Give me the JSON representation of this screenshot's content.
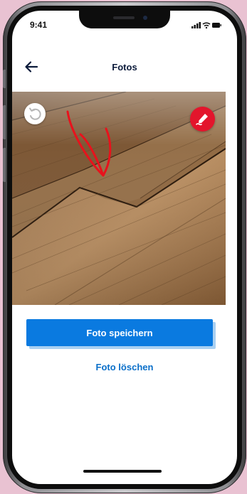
{
  "status_bar": {
    "time": "9:41",
    "icons": [
      "signal-icon",
      "wifi-icon",
      "battery-icon"
    ]
  },
  "header": {
    "title": "Fotos",
    "back_icon": "arrow-left-icon"
  },
  "photo": {
    "description_icon_left": "reset-rotate-icon",
    "description_icon_right": "draw-pen-icon",
    "annotation_color": "#e8121c"
  },
  "actions": {
    "save_label": "Foto speichern",
    "delete_label": "Foto löschen"
  },
  "colors": {
    "primary": "#0a7ae0",
    "primary_shadow": "#a9d0f2",
    "link": "#0a6fc9",
    "title": "#0b1a3a",
    "draw_button": "#e3152c",
    "background": "#e9c2d2"
  }
}
